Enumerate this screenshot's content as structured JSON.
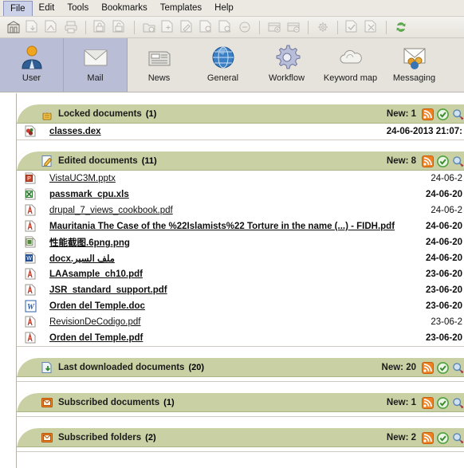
{
  "menubar": {
    "items": [
      {
        "label": "File",
        "selected": true
      },
      {
        "label": "Edit",
        "selected": false
      },
      {
        "label": "Tools",
        "selected": false
      },
      {
        "label": "Bookmarks",
        "selected": false
      },
      {
        "label": "Templates",
        "selected": false
      },
      {
        "label": "Help",
        "selected": false
      }
    ]
  },
  "toolbar": {
    "buttons": [
      {
        "name": "archive-icon",
        "enabled": true
      },
      {
        "name": "document-download-icon",
        "enabled": false
      },
      {
        "name": "document-export-icon",
        "enabled": false
      },
      {
        "name": "print-icon",
        "enabled": false
      },
      {
        "name": "separator-1",
        "separator": true
      },
      {
        "name": "lock-document-icon",
        "enabled": false
      },
      {
        "name": "unlock-document-icon",
        "enabled": false
      },
      {
        "name": "separator-2",
        "separator": true
      },
      {
        "name": "new-folder-icon",
        "enabled": false
      },
      {
        "name": "new-document-icon",
        "enabled": false
      },
      {
        "name": "edit-document-icon",
        "enabled": false
      },
      {
        "name": "document-properties-icon",
        "enabled": false
      },
      {
        "name": "document-info-icon",
        "enabled": false
      },
      {
        "name": "delete-icon",
        "enabled": false
      },
      {
        "name": "separator-3",
        "separator": true
      },
      {
        "name": "add-record-icon",
        "enabled": false
      },
      {
        "name": "remove-record-icon",
        "enabled": false
      },
      {
        "name": "separator-4",
        "separator": true
      },
      {
        "name": "settings-gear-icon",
        "enabled": false
      },
      {
        "name": "separator-5",
        "separator": true
      },
      {
        "name": "approve-document-icon",
        "enabled": false
      },
      {
        "name": "reject-document-icon",
        "enabled": false
      },
      {
        "name": "separator-6",
        "separator": true
      },
      {
        "name": "refresh-sync-icon",
        "enabled": true
      }
    ]
  },
  "tabstrip": {
    "tabs": [
      {
        "label": "User",
        "icon": "user-icon",
        "selected": true
      },
      {
        "label": "Mail",
        "icon": "mail-icon",
        "selected": true
      },
      {
        "label": "News",
        "icon": "news-icon",
        "selected": false
      },
      {
        "label": "General",
        "icon": "globe-icon",
        "selected": false
      },
      {
        "label": "Workflow",
        "icon": "gear-icon",
        "selected": false
      },
      {
        "label": "Keyword map",
        "icon": "cloud-icon",
        "selected": false
      },
      {
        "label": "Messaging",
        "icon": "messaging-icon",
        "selected": false
      }
    ]
  },
  "colors": {
    "section_header_bg": "#c9d1a4",
    "selected_tab_bg": "#b9bdd6",
    "menu_selected_bg": "#ccd2ea",
    "rss_orange": "#f08020",
    "check_green": "#4ea13c"
  },
  "sections": [
    {
      "title": "Locked documents",
      "count": "(1)",
      "icon": "lock-icon",
      "new_label": "New: 1",
      "actions": [
        "rss-icon",
        "mark-read-icon",
        "search-icon"
      ],
      "rows": [
        {
          "icon": "dex-file-icon",
          "name": "classes.dex",
          "date": "24-06-2013 21:07:",
          "unread": true,
          "rtl": false
        }
      ]
    },
    {
      "title": "Edited documents",
      "count": "(11)",
      "icon": "edit-icon",
      "new_label": "New: 8",
      "actions": [
        "rss-icon",
        "mark-read-icon",
        "search-icon"
      ],
      "rows": [
        {
          "icon": "powerpoint-file-icon",
          "name": "VistaUC3M.pptx",
          "date": "24-06-2",
          "unread": false,
          "rtl": false
        },
        {
          "icon": "excel-file-icon",
          "name": "passmark_cpu.xls",
          "date": "24-06-20",
          "unread": true,
          "rtl": false
        },
        {
          "icon": "pdf-file-icon",
          "name": "drupal_7_views_cookbook.pdf",
          "date": "24-06-2",
          "unread": false,
          "rtl": false
        },
        {
          "icon": "pdf-file-icon",
          "name": "Mauritania The Case of the %22Islamists%22 Torture in the name (...) - FIDH.pdf",
          "date": "24-06-20",
          "unread": true,
          "rtl": false
        },
        {
          "icon": "image-file-icon",
          "name": "性能截图.6png.png",
          "date": "24-06-20",
          "unread": true,
          "rtl": false
        },
        {
          "icon": "word-file-icon",
          "name": "ملف السير.docx",
          "date": "24-06-20",
          "unread": true,
          "rtl": true
        },
        {
          "icon": "pdf-file-icon",
          "name": "LAAsample_ch10.pdf",
          "date": "23-06-20",
          "unread": true,
          "rtl": false
        },
        {
          "icon": "pdf-file-icon",
          "name": "JSR_standard_support.pdf",
          "date": "23-06-20",
          "unread": true,
          "rtl": false
        },
        {
          "icon": "word-doc-file-icon",
          "name": "Orden del Temple.doc",
          "date": "23-06-20",
          "unread": true,
          "rtl": false
        },
        {
          "icon": "pdf-file-icon",
          "name": "RevisionDeCodigo.pdf",
          "date": "23-06-2",
          "unread": false,
          "rtl": false
        },
        {
          "icon": "pdf-file-icon",
          "name": "Orden del Temple.pdf",
          "date": "23-06-20",
          "unread": true,
          "rtl": false
        }
      ]
    },
    {
      "title": "Last downloaded documents",
      "count": "(20)",
      "icon": "download-doc-icon",
      "new_label": "New: 20",
      "actions": [
        "rss-icon",
        "mark-read-icon",
        "search-icon"
      ],
      "rows": []
    },
    {
      "title": "Subscribed documents",
      "count": "(1)",
      "icon": "envelope-icon",
      "new_label": "New: 1",
      "actions": [
        "rss-icon",
        "mark-read-icon",
        "search-icon"
      ],
      "rows": []
    },
    {
      "title": "Subscribed folders",
      "count": "(2)",
      "icon": "envelope-icon",
      "new_label": "New: 2",
      "actions": [
        "rss-icon",
        "mark-read-icon",
        "search-icon"
      ],
      "rows": []
    }
  ]
}
